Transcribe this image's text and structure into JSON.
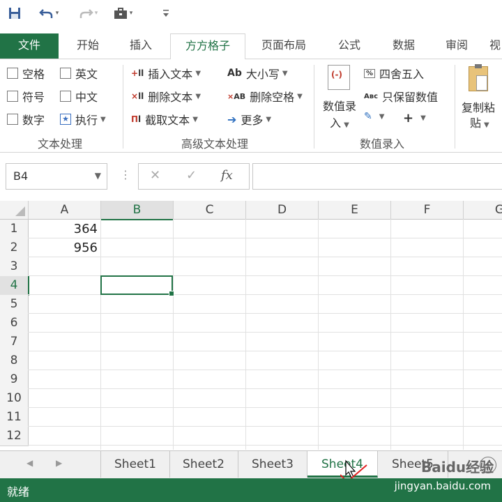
{
  "qat": {
    "save_icon": "save-icon",
    "undo_icon": "undo-icon",
    "redo_icon": "redo-icon",
    "briefcase_icon": "briefcase-icon",
    "customize_icon": "customize-qat-icon"
  },
  "tabs": [
    {
      "label": "文件"
    },
    {
      "label": "开始"
    },
    {
      "label": "插入"
    },
    {
      "label": "方方格子"
    },
    {
      "label": "页面布局"
    },
    {
      "label": "公式"
    },
    {
      "label": "数据"
    },
    {
      "label": "审阅"
    },
    {
      "label": "视"
    }
  ],
  "ribbon": {
    "text_group": {
      "label": "文本处理",
      "items": [
        "空格",
        "英文",
        "符号",
        "中文",
        "数字",
        "执行"
      ]
    },
    "adv_group": {
      "label": "高级文本处理",
      "insert": "插入文本",
      "delete": "删除文本",
      "extract": "截取文本",
      "case": "大小写",
      "delspace": "删除空格",
      "more": "更多"
    },
    "num_group": {
      "label": "数值录入",
      "big": "数值录",
      "big2": "入",
      "round": "四舍五入",
      "keep": "只保留数值",
      "plus": "+"
    },
    "copy": {
      "line1": "复制粘",
      "line2": "贴"
    }
  },
  "formula_bar": {
    "namebox": "B4",
    "fx": "fx",
    "cancel": "✕",
    "enter": "✓",
    "value": ""
  },
  "grid": {
    "columns": [
      "A",
      "B",
      "C",
      "D",
      "E",
      "F",
      "G"
    ],
    "rows": [
      "1",
      "2",
      "3",
      "4",
      "5",
      "6",
      "7",
      "8",
      "9",
      "10",
      "11",
      "12"
    ],
    "cells": {
      "A1": "364",
      "A2": "956"
    },
    "selected": "B4"
  },
  "sheets": [
    "Sheet1",
    "Sheet2",
    "Sheet3",
    "Sheet4",
    "Sheet5"
  ],
  "active_sheet": "Sheet4",
  "status": {
    "text": "就绪",
    "watermark": "jingyan.baidu.com",
    "watermark2": "Baidu经验"
  },
  "colors": {
    "accent": "#217346"
  }
}
